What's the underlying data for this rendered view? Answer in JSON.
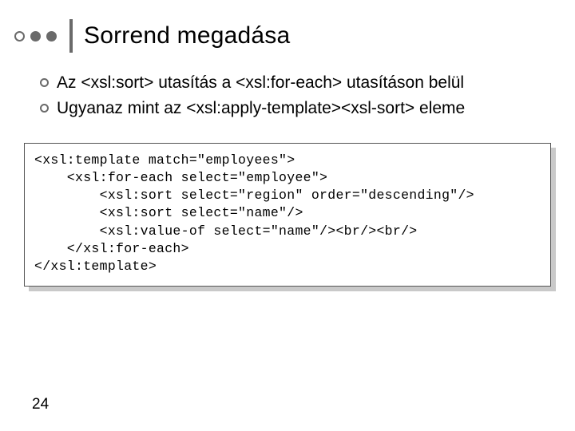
{
  "title": "Sorrend megadása",
  "bullets": [
    "Az  <xsl:sort> utasítás a <xsl:for-each> utasításon belül",
    "Ugyanaz mint az <xsl:apply-template><xsl-sort> eleme"
  ],
  "code": "<xsl:template match=\"employees\">\n    <xsl:for-each select=\"employee\">\n        <xsl:sort select=\"region\" order=\"descending\"/>\n        <xsl:sort select=\"name\"/>\n        <xsl:value-of select=\"name\"/><br/><br/>\n    </xsl:for-each>\n</xsl:template>",
  "page_number": "24"
}
